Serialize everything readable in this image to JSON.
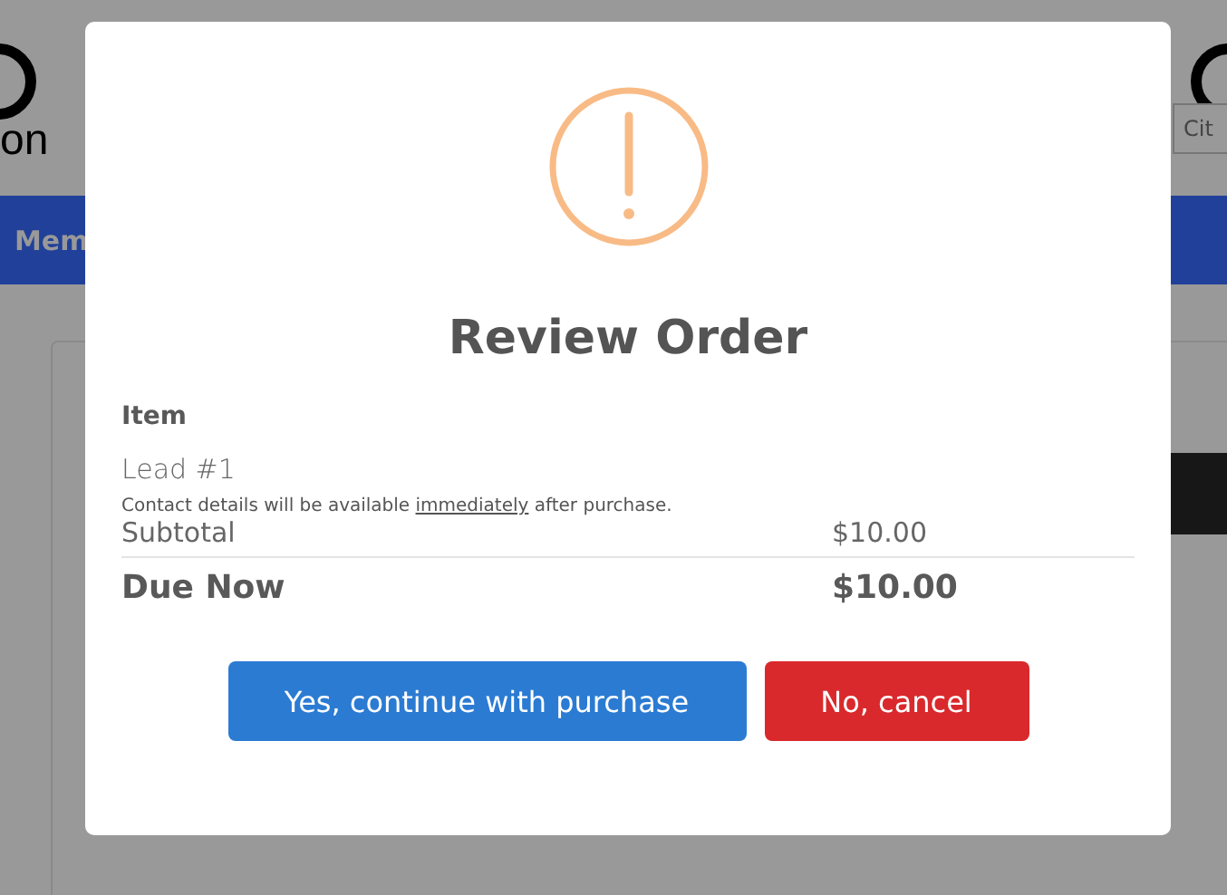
{
  "background": {
    "logo_text": "on",
    "nav_item": "Mem",
    "city_field": {
      "placeholder": "Cit"
    }
  },
  "dialog": {
    "title": "Review Order",
    "item_heading": "Item",
    "item_name": "Lead #1",
    "note": {
      "before": "Contact details will be available ",
      "underlined": "immediately",
      "after": " after purchase."
    },
    "subtotal": {
      "label": "Subtotal",
      "amount": "$10.00"
    },
    "due": {
      "label": "Due Now",
      "amount": "$10.00"
    },
    "buttons": [
      {
        "label": "Yes, continue with purchase",
        "kind": "confirm"
      },
      {
        "label": "No, cancel",
        "kind": "cancel"
      }
    ]
  }
}
